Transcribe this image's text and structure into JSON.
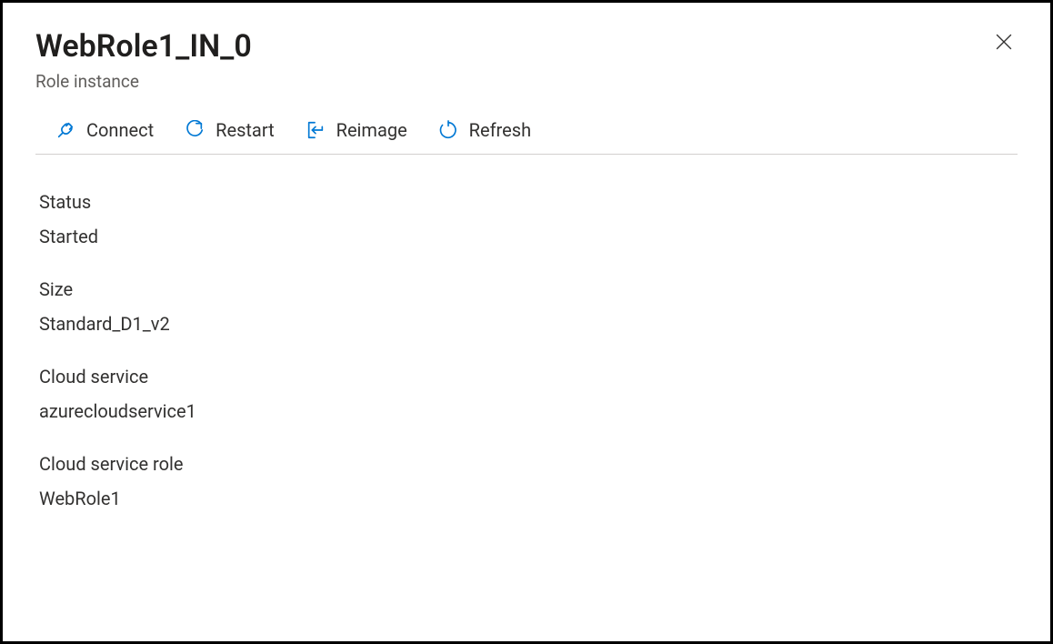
{
  "header": {
    "title": "WebRole1_IN_0",
    "subtitle": "Role instance"
  },
  "toolbar": {
    "connect": "Connect",
    "restart": "Restart",
    "reimage": "Reimage",
    "refresh": "Refresh"
  },
  "details": {
    "status": {
      "label": "Status",
      "value": "Started"
    },
    "size": {
      "label": "Size",
      "value": "Standard_D1_v2"
    },
    "cloud_service": {
      "label": "Cloud service",
      "value": "azurecloudservice1"
    },
    "cloud_service_role": {
      "label": "Cloud service role",
      "value": "WebRole1"
    }
  }
}
